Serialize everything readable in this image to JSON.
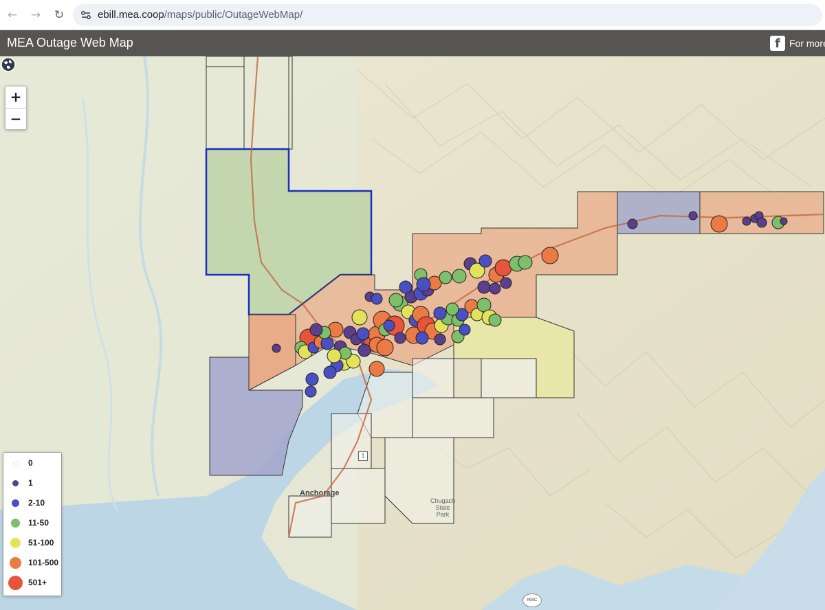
{
  "browser": {
    "url_host": "ebill.mea.coop",
    "url_path": "/maps/public/OutageWebMap/"
  },
  "header": {
    "title": "MEA Outage Web Map",
    "facebook_text": "For more"
  },
  "map": {
    "zoom_in_label": "+",
    "zoom_out_label": "−",
    "labels": {
      "anchorage": "Anchorage",
      "chugach": "Chugach State Park",
      "highway": "1"
    },
    "logo_text": "NISC"
  },
  "legend": {
    "items": [
      {
        "label": "0",
        "color": "#ffffff"
      },
      {
        "label": "1",
        "color": "#5b3f8c"
      },
      {
        "label": "2-10",
        "color": "#4a4fc4"
      },
      {
        "label": "11-50",
        "color": "#7dbf6a"
      },
      {
        "label": "51-100",
        "color": "#e2e35a"
      },
      {
        "label": "101-500",
        "color": "#ec7a44"
      },
      {
        "label": "501+",
        "color": "#e8543a"
      }
    ]
  }
}
